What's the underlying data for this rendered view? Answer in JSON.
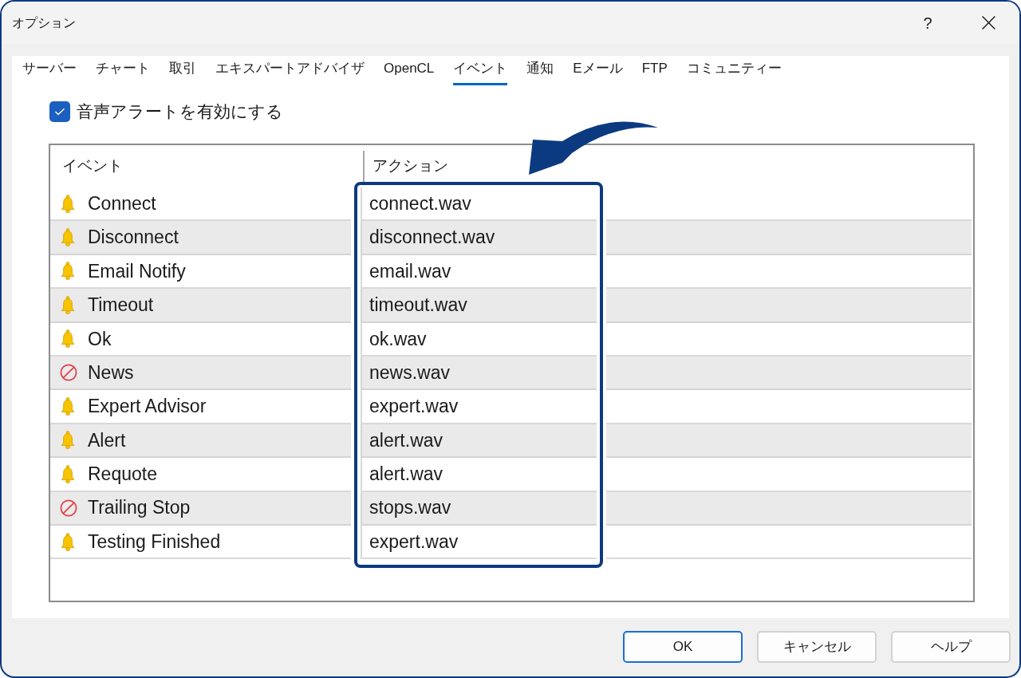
{
  "window": {
    "title": "オプション",
    "help_button": "?"
  },
  "tabs": [
    {
      "label": "サーバー",
      "selected": false
    },
    {
      "label": "チャート",
      "selected": false
    },
    {
      "label": "取引",
      "selected": false
    },
    {
      "label": "エキスパートアドバイザ",
      "selected": false
    },
    {
      "label": "OpenCL",
      "selected": false
    },
    {
      "label": "イベント",
      "selected": true
    },
    {
      "label": "通知",
      "selected": false
    },
    {
      "label": "Eメール",
      "selected": false
    },
    {
      "label": "FTP",
      "selected": false
    },
    {
      "label": "コミュニティー",
      "selected": false
    }
  ],
  "sound_alert_option": {
    "label": "音声アラートを有効にする",
    "checked": true
  },
  "event_table": {
    "columns": [
      "イベント",
      "アクション"
    ],
    "rows": [
      {
        "event": "Connect",
        "enabled": true,
        "action": "connect.wav"
      },
      {
        "event": "Disconnect",
        "enabled": true,
        "action": "disconnect.wav"
      },
      {
        "event": "Email Notify",
        "enabled": true,
        "action": "email.wav"
      },
      {
        "event": "Timeout",
        "enabled": true,
        "action": "timeout.wav"
      },
      {
        "event": "Ok",
        "enabled": true,
        "action": "ok.wav"
      },
      {
        "event": "News",
        "enabled": false,
        "action": "news.wav"
      },
      {
        "event": "Expert Advisor",
        "enabled": true,
        "action": "expert.wav"
      },
      {
        "event": "Alert",
        "enabled": true,
        "action": "alert.wav"
      },
      {
        "event": "Requote",
        "enabled": true,
        "action": "alert.wav"
      },
      {
        "event": "Trailing Stop",
        "enabled": false,
        "action": "stops.wav"
      },
      {
        "event": "Testing Finished",
        "enabled": true,
        "action": "expert.wav"
      }
    ]
  },
  "buttons": [
    {
      "label": "OK",
      "default": true
    },
    {
      "label": "キャンセル",
      "default": false
    },
    {
      "label": "ヘルプ",
      "default": false
    }
  ]
}
